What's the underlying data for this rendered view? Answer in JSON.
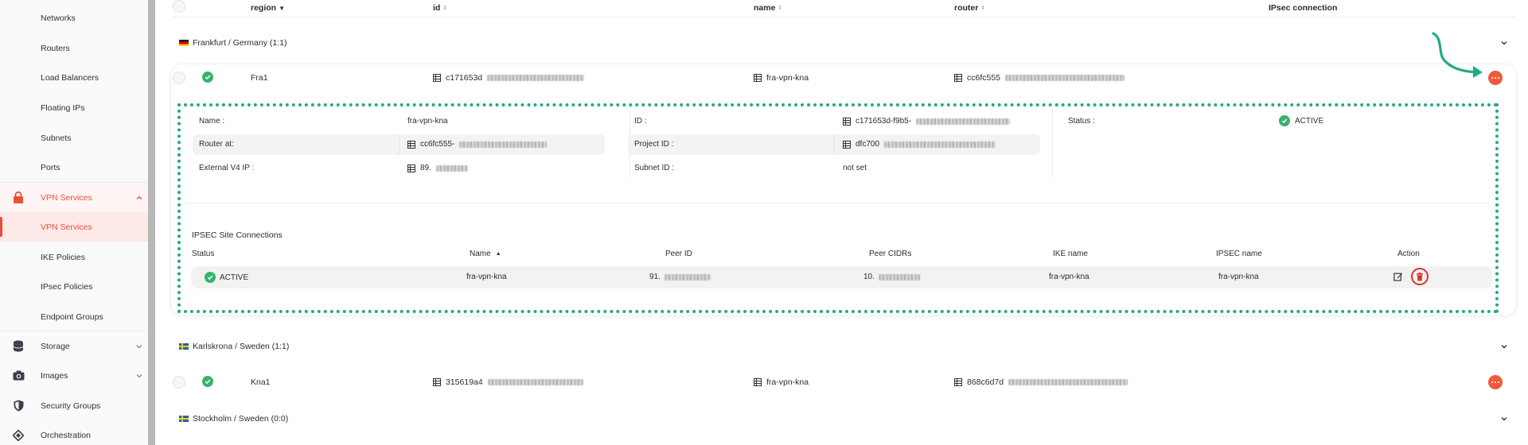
{
  "sidebar": {
    "items": [
      {
        "label": "Networks"
      },
      {
        "label": "Routers"
      },
      {
        "label": "Load Balancers"
      },
      {
        "label": "Floating IPs"
      },
      {
        "label": "Subnets"
      },
      {
        "label": "Ports"
      },
      {
        "label": "VPN Services"
      },
      {
        "label": "VPN Services"
      },
      {
        "label": "IKE Policies"
      },
      {
        "label": "IPsec Policies"
      },
      {
        "label": "Endpoint Groups"
      },
      {
        "label": "Storage"
      },
      {
        "label": "Images"
      },
      {
        "label": "Security Groups"
      },
      {
        "label": "Orchestration"
      }
    ]
  },
  "table": {
    "headers": {
      "region": "region",
      "id": "id",
      "name": "name",
      "router": "router",
      "ipsec": "IPsec connection"
    }
  },
  "groups": [
    {
      "title": "Frankfurt / Germany (1:1)"
    },
    {
      "title": "Karlskrona / Sweden (1:1)"
    },
    {
      "title": "Stockholm / Sweden (0:0)"
    }
  ],
  "rows": [
    {
      "region": "Fra1",
      "id": "c171653d",
      "name": "fra-vpn-kna",
      "router": "cc6fc555"
    },
    {
      "region": "Kna1",
      "id": "315619a4",
      "name": "fra-vpn-kna",
      "router": "868c6d7d"
    }
  ],
  "detail": {
    "name_label": "Name :",
    "name_value": "fra-vpn-kna",
    "router_label": "Router at:",
    "router_value": "cc6fc555-",
    "ext_ip_label": "External V4 IP :",
    "ext_ip_value": "89.",
    "id_label": "ID :",
    "id_value": "c171653d-f9b5-",
    "project_label": "Project ID :",
    "project_value": "dfc700",
    "subnet_label": "Subnet ID :",
    "subnet_value": "not set",
    "status_label": "Status :",
    "status_value": "ACTIVE"
  },
  "ipsec": {
    "title": "IPSEC Site Connections",
    "headers": {
      "status": "Status",
      "name": "Name",
      "peer_id": "Peer ID",
      "peer_cidrs": "Peer CIDRs",
      "ike": "IKE name",
      "ipsec": "IPSEC name",
      "action": "Action"
    },
    "rows": [
      {
        "status": "ACTIVE",
        "name": "fra-vpn-kna",
        "peer_id": "91.",
        "peer_cidrs": "10.",
        "ike": "fra-vpn-kna",
        "ipsec": "fra-vpn-kna"
      }
    ]
  },
  "colors": {
    "accent": "#e8503a",
    "success": "#37b26c",
    "highlight": "#22a986",
    "danger": "#d9352a"
  }
}
